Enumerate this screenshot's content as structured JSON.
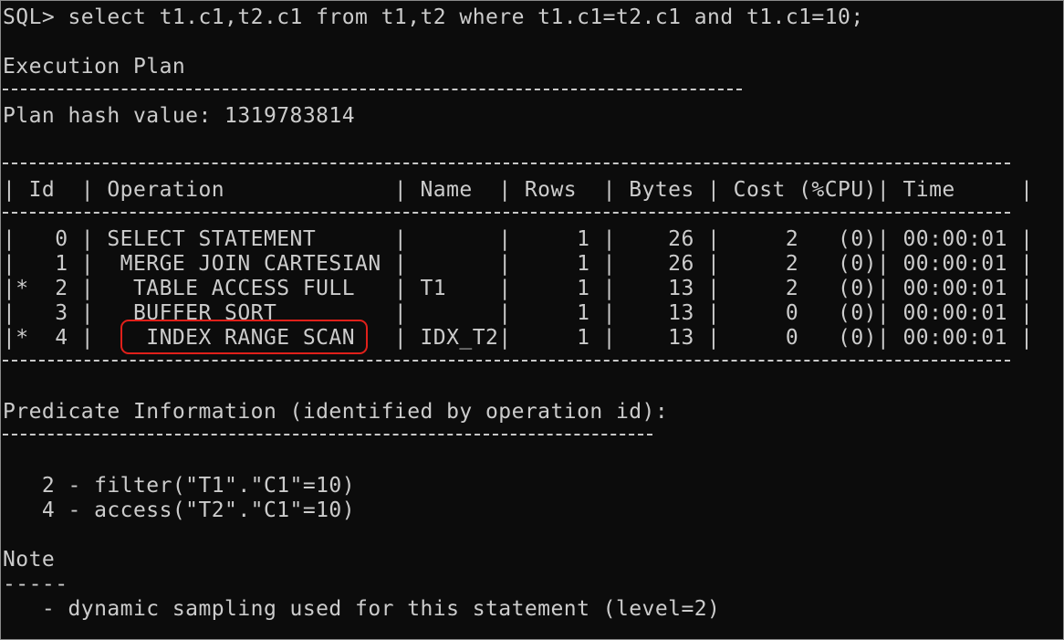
{
  "terminal": {
    "command": "SQL> select t1.c1,t2.c1 from t1,t2 where t1.c1=t2.c1 and t1.c1=10;",
    "plan_title": "Execution Plan",
    "plan_hash": "Plan hash value: 1319783814",
    "table": {
      "header": "| Id  | Operation             | Name  | Rows  | Bytes | Cost (%CPU)| Time     |",
      "rows": [
        "|   0 | SELECT STATEMENT      |       |     1 |    26 |     2   (0)| 00:00:01 |",
        "|   1 |  MERGE JOIN CARTESIAN |       |     1 |    26 |     2   (0)| 00:00:01 |",
        "|*  2 |   TABLE ACCESS FULL   | T1    |     1 |    13 |     2   (0)| 00:00:01 |",
        "|   3 |   BUFFER SORT         |       |     1 |    13 |     0   (0)| 00:00:01 |",
        "|*  4 |    INDEX RANGE SCAN   | IDX_T2|     1 |    13 |     0   (0)| 00:00:01 |"
      ]
    },
    "predicate_title": "Predicate Information (identified by operation id):",
    "predicates": [
      "   2 - filter(\"T1\".\"C1\"=10)",
      "   4 - access(\"T2\".\"C1\"=10)"
    ],
    "note_title": "Note",
    "note_dashes": "-----",
    "note_text": "   - dynamic sampling used for this statement (level=2)",
    "highlight_label": "INDEX RANGE SCAN"
  },
  "colors": {
    "background": "#0c0c0c",
    "text": "#cccccc",
    "highlight": "#e0201a"
  }
}
